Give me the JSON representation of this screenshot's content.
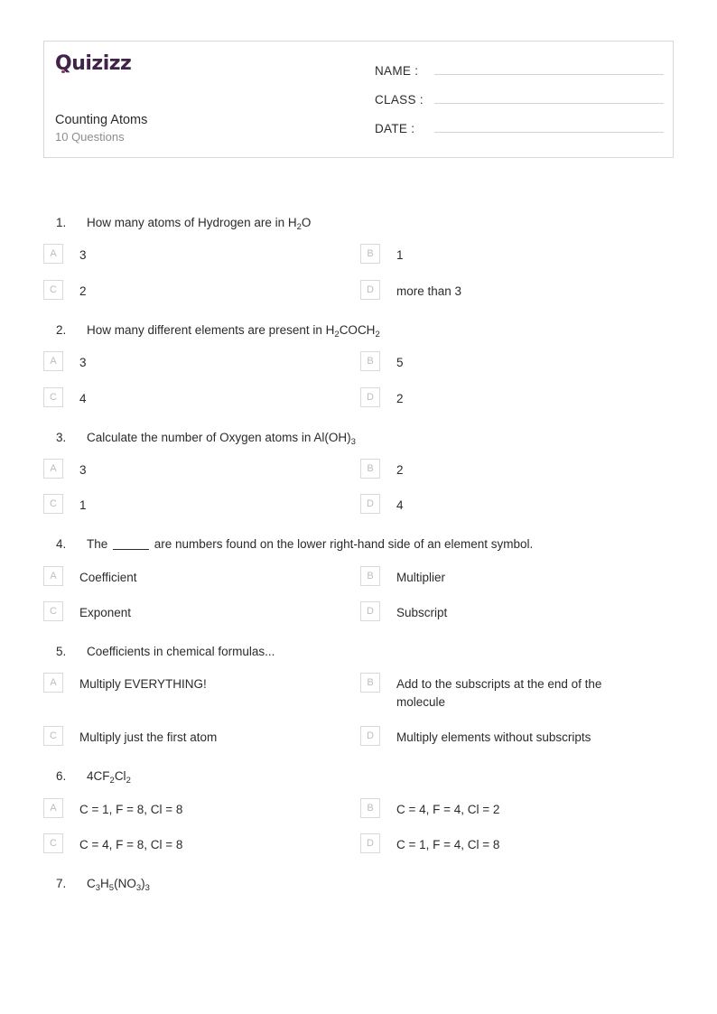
{
  "header": {
    "logo_text": "Quizizz",
    "quiz_title": "Counting Atoms",
    "question_count_label": "10 Questions",
    "fields": [
      {
        "label": "NAME :",
        "value": ""
      },
      {
        "label": "CLASS :",
        "value": ""
      },
      {
        "label": "DATE  :",
        "value": ""
      }
    ]
  },
  "accent_color": "#41234a",
  "questions": [
    {
      "number": "1.",
      "text_html": "How many atoms of Hydrogen are in H<sub>2</sub>O",
      "options": [
        {
          "letter": "A",
          "text_html": "3"
        },
        {
          "letter": "B",
          "text_html": "1"
        },
        {
          "letter": "C",
          "text_html": "2"
        },
        {
          "letter": "D",
          "text_html": "more than 3"
        }
      ]
    },
    {
      "number": "2.",
      "text_html": "How many different elements are present in H<sub>2</sub>COCH<sub>2</sub>",
      "options": [
        {
          "letter": "A",
          "text_html": "3"
        },
        {
          "letter": "B",
          "text_html": "5"
        },
        {
          "letter": "C",
          "text_html": "4"
        },
        {
          "letter": "D",
          "text_html": "2"
        }
      ]
    },
    {
      "number": "3.",
      "text_html": "Calculate the number of Oxygen atoms in Al(OH)<sub>3</sub>",
      "options": [
        {
          "letter": "A",
          "text_html": "3"
        },
        {
          "letter": "B",
          "text_html": "2"
        },
        {
          "letter": "C",
          "text_html": "1"
        },
        {
          "letter": "D",
          "text_html": "4"
        }
      ]
    },
    {
      "number": "4.",
      "text_html": "The <span class=\"blank\"></span> are numbers found on the lower right-hand side of an element symbol.",
      "options": [
        {
          "letter": "A",
          "text_html": "Coefficient"
        },
        {
          "letter": "B",
          "text_html": "Multiplier"
        },
        {
          "letter": "C",
          "text_html": "Exponent"
        },
        {
          "letter": "D",
          "text_html": "Subscript"
        }
      ]
    },
    {
      "number": "5.",
      "text_html": "Coefficients in chemical formulas...",
      "options": [
        {
          "letter": "A",
          "text_html": "Multiply EVERYTHING!"
        },
        {
          "letter": "B",
          "text_html": "Add to the subscripts at the end of the molecule"
        },
        {
          "letter": "C",
          "text_html": "Multiply just the first atom"
        },
        {
          "letter": "D",
          "text_html": "Multiply elements without subscripts"
        }
      ]
    },
    {
      "number": "6.",
      "text_html": "4CF<sub>2</sub>Cl<sub>2</sub>",
      "options": [
        {
          "letter": "A",
          "text_html": "C = 1, F = 8, Cl = 8"
        },
        {
          "letter": "B",
          "text_html": "C = 4, F = 4, Cl = 2"
        },
        {
          "letter": "C",
          "text_html": "C = 4, F = 8, Cl = 8"
        },
        {
          "letter": "D",
          "text_html": "C = 1, F = 4, Cl = 8"
        }
      ]
    },
    {
      "number": "7.",
      "text_html": "C<sub>3</sub>H<sub>5</sub>(NO<sub>3</sub>)<sub>3</sub>",
      "options": []
    }
  ]
}
